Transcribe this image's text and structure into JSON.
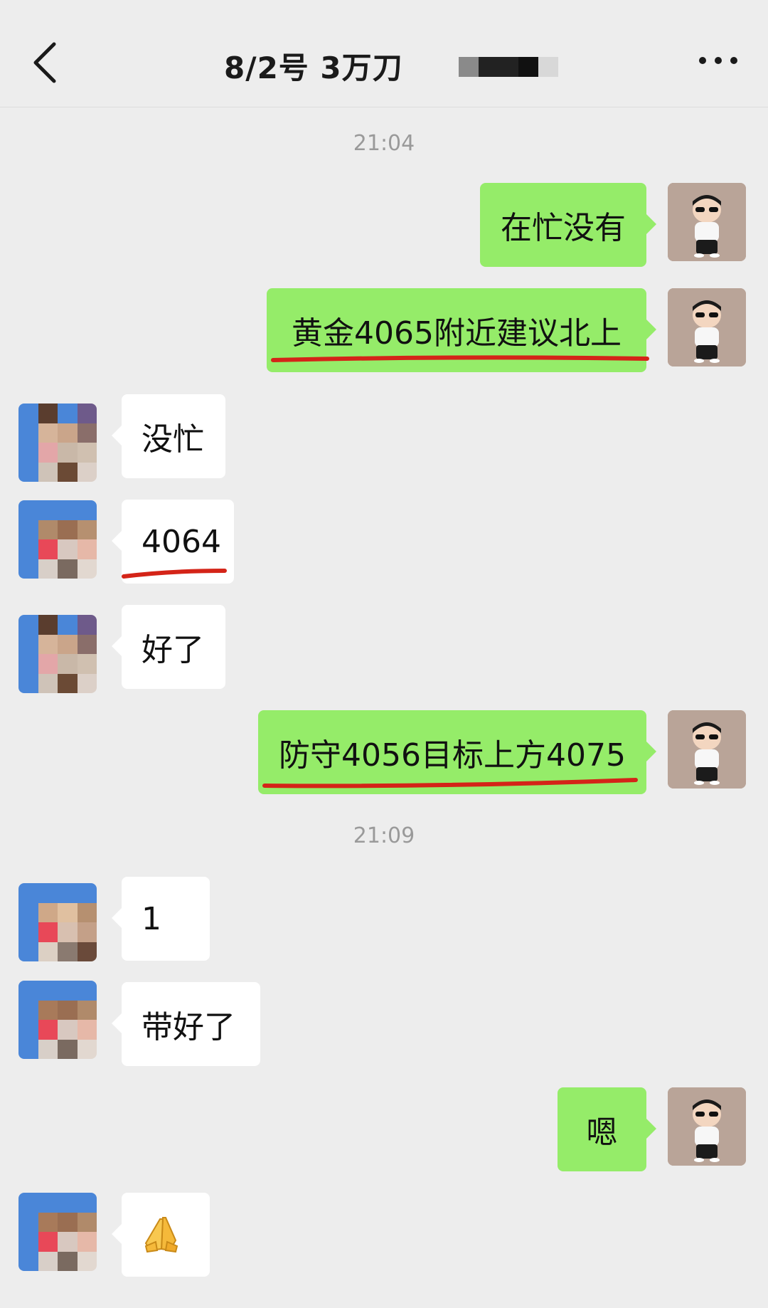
{
  "header": {
    "title": "8/2号  3万刀",
    "back_icon": "chevron-left-icon",
    "more_icon": "more-dots-icon"
  },
  "timestamps": [
    "21:04",
    "21:09"
  ],
  "messages": [
    {
      "from": "me",
      "text": "在忙没有"
    },
    {
      "from": "me",
      "text": "黄金4065附近建议北上",
      "underlined": true
    },
    {
      "from": "other",
      "text": "没忙"
    },
    {
      "from": "other",
      "text": "4064",
      "underlined": true
    },
    {
      "from": "other",
      "text": "好了"
    },
    {
      "from": "me",
      "text": "防守4056目标上方4075",
      "underlined": true
    },
    {
      "from": "other",
      "text": "1"
    },
    {
      "from": "other",
      "text": "带好了"
    },
    {
      "from": "me",
      "text": "嗯"
    },
    {
      "from": "other",
      "text": "🙏",
      "emoji_name": "folded-hands-emoji"
    }
  ],
  "colors": {
    "background": "#ededed",
    "my_bubble": "#95ec69",
    "their_bubble": "#ffffff",
    "underline": "#d42418",
    "timestamp": "#9a9a9a"
  }
}
